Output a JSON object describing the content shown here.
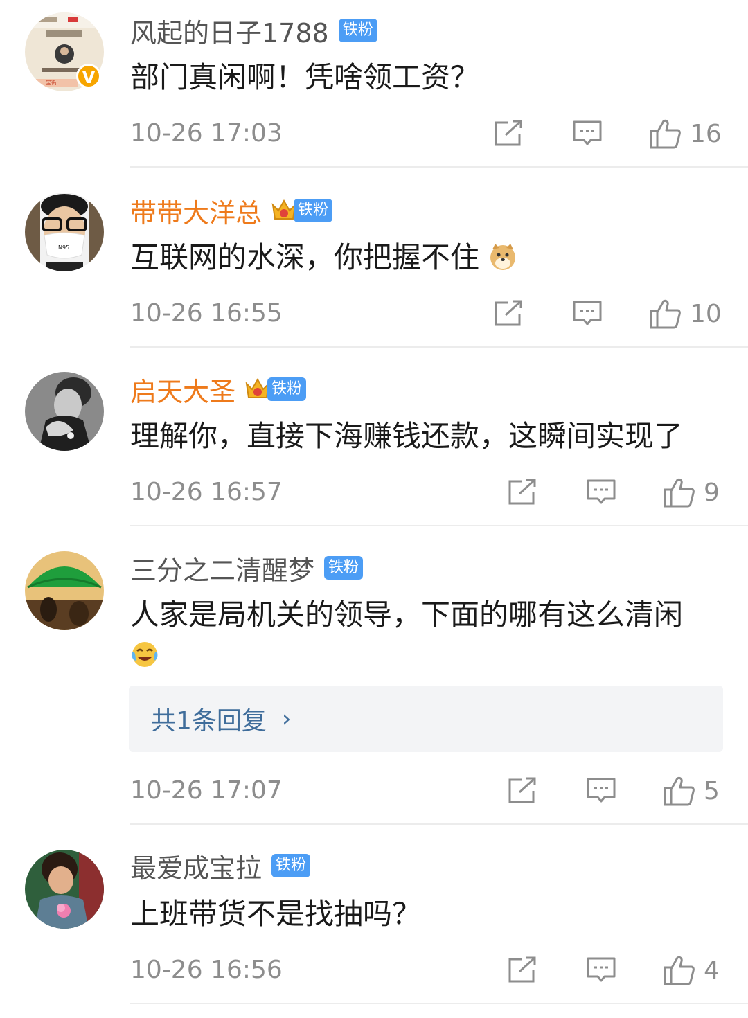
{
  "colors": {
    "username_default": "#555555",
    "username_vip": "#ee7a1b",
    "fan_badge": "#4c9df5",
    "meta_text": "#8d8d8d",
    "reply_link": "#3f6d9b",
    "reply_box_bg": "#f3f4f6"
  },
  "comments": [
    {
      "username": "风起的日子1788",
      "vip": false,
      "badge": "铁粉",
      "verified": true,
      "avatar_icon": "investment-report-avatar",
      "text": "部门真闲啊！凭啥领工资？",
      "timestamp": "10-26 17:03",
      "likes": "16"
    },
    {
      "username": "带带大洋总",
      "vip": true,
      "badge": "铁粉",
      "avatar_icon": "masked-man-avatar",
      "text": "互联网的水深，你把握不住",
      "emoji": "doge-emoji",
      "timestamp": "10-26 16:55",
      "likes": "10"
    },
    {
      "username": "启天大圣",
      "vip": true,
      "badge": "铁粉",
      "avatar_icon": "grayscale-portrait-avatar",
      "text": "理解你，直接下海赚钱还款，这瞬间实现了",
      "timestamp": "10-26 16:57",
      "likes": "9"
    },
    {
      "username": "三分之二清醒梦",
      "vip": false,
      "badge": "铁粉",
      "avatar_icon": "green-umbrella-avatar",
      "text": "人家是局机关的领导，下面的哪有这么清闲",
      "emoji": "laughing-crying-emoji",
      "reply_summary": "共1条回复",
      "timestamp": "10-26 17:07",
      "likes": "5"
    },
    {
      "username": "最爱成宝拉",
      "vip": false,
      "badge": "铁粉",
      "avatar_icon": "woman-holding-flower-avatar",
      "text": "上班带货不是找抽吗？",
      "timestamp": "10-26 16:56",
      "likes": "4"
    }
  ]
}
